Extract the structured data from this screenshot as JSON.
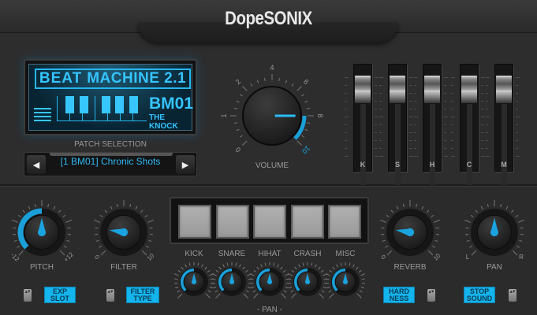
{
  "app": {
    "title": "DopeSONIX"
  },
  "lcd": {
    "brand": "BEAT",
    "product": "MACHINE 2.1",
    "patch_code": "BM01",
    "patch_subtitle": "THE KNOCK"
  },
  "patch_selection": {
    "label": "PATCH SELECTION",
    "current": "[1 BM01] Chronic Shots",
    "prev_icon": "triangle-left-icon",
    "next_icon": "triangle-right-icon"
  },
  "volume": {
    "label": "VOLUME",
    "scale": [
      "0",
      "1",
      "2",
      "4",
      "6",
      "8",
      "10"
    ],
    "value": 8
  },
  "faders": [
    {
      "label": "K",
      "value": 0.95
    },
    {
      "label": "S",
      "value": 0.95
    },
    {
      "label": "H",
      "value": 0.95
    },
    {
      "label": "C",
      "value": 0.95
    },
    {
      "label": "M",
      "value": 0.95
    }
  ],
  "knobs": {
    "pitch": {
      "label": "PITCH",
      "min_label": "-12",
      "max_label": "+12",
      "value": 0.5
    },
    "filter": {
      "label": "FILTER",
      "min_label": "0",
      "max_label": "10",
      "value": 0.2
    },
    "reverb": {
      "label": "REVERB",
      "min_label": "0",
      "max_label": "10",
      "value": 0.2
    },
    "pan": {
      "label": "PAN",
      "min_label": "L",
      "max_label": "R",
      "value": 0.5
    }
  },
  "pads": [
    {
      "label": "KICK",
      "pan": 0.5
    },
    {
      "label": "SNARE",
      "pan": 0.5
    },
    {
      "label": "HIHAT",
      "pan": 0.5
    },
    {
      "label": "CRASH",
      "pan": 0.5
    },
    {
      "label": "MISC",
      "pan": 0.5
    }
  ],
  "pads_pan_label": "- PAN -",
  "buttons": {
    "exp_slot": [
      "EXP",
      "SLOT"
    ],
    "filter_type": [
      "FILTER",
      "TYPE"
    ],
    "hardness": [
      "HARD",
      "NESS"
    ],
    "stop_sound": [
      "STOP",
      "SOUND"
    ]
  },
  "spinner_glyph": "▴▾",
  "colors": {
    "accent": "#14b4ec",
    "lcd": "#35c4ff",
    "bg": "#2d2d2e"
  }
}
